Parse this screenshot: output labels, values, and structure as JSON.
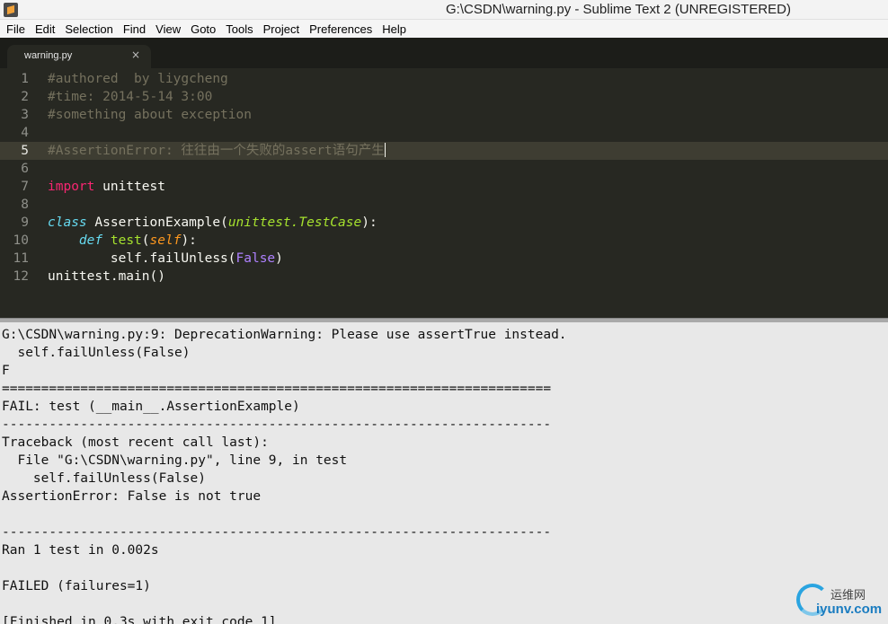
{
  "window": {
    "title": "G:\\CSDN\\warning.py - Sublime Text 2 (UNREGISTERED)"
  },
  "menu": [
    {
      "label": "File",
      "name": "menu-file"
    },
    {
      "label": "Edit",
      "name": "menu-edit"
    },
    {
      "label": "Selection",
      "name": "menu-selection"
    },
    {
      "label": "Find",
      "name": "menu-find"
    },
    {
      "label": "View",
      "name": "menu-view"
    },
    {
      "label": "Goto",
      "name": "menu-goto"
    },
    {
      "label": "Tools",
      "name": "menu-tools"
    },
    {
      "label": "Project",
      "name": "menu-project"
    },
    {
      "label": "Preferences",
      "name": "menu-preferences"
    },
    {
      "label": "Help",
      "name": "menu-help"
    }
  ],
  "tabs": [
    {
      "label": "warning.py",
      "close": "×",
      "active": true
    }
  ],
  "editor": {
    "active_line": 5,
    "line_numbers": [
      "1",
      "2",
      "3",
      "4",
      "5",
      "6",
      "7",
      "8",
      "9",
      "10",
      "11",
      "12"
    ],
    "lines": {
      "l1": "#authored  by liygcheng",
      "l2": "#time: 2014-5-14 3:00",
      "l3": "#something about exception",
      "l4": "",
      "l5": "#AssertionError: 往往由一个失败的assert语句产生",
      "l6": "",
      "l7_kw": "import",
      "l7_rest": " unittest",
      "l8": "",
      "l9_kw": "class",
      "l9_name": "AssertionExample",
      "l9_open": "(",
      "l9_parent": "unittest.TestCase",
      "l9_close": "):",
      "l10_indent": "    ",
      "l10_kw": "def",
      "l10_sp": " ",
      "l10_name": "test",
      "l10_open": "(",
      "l10_param": "self",
      "l10_close": "):",
      "l11_pre": "        self.failUnless(",
      "l11_const": "False",
      "l11_post": ")",
      "l12": "unittest.main()"
    }
  },
  "output": {
    "lines": [
      "G:\\CSDN\\warning.py:9: DeprecationWarning: Please use assertTrue instead.",
      "  self.failUnless(False)",
      "F",
      "======================================================================",
      "FAIL: test (__main__.AssertionExample)",
      "----------------------------------------------------------------------",
      "Traceback (most recent call last):",
      "  File \"G:\\CSDN\\warning.py\", line 9, in test",
      "    self.failUnless(False)",
      "AssertionError: False is not true",
      "",
      "----------------------------------------------------------------------",
      "Ran 1 test in 0.002s",
      "",
      "FAILED (failures=1)",
      "",
      "[Finished in 0.3s with exit code 1]"
    ]
  },
  "watermark": {
    "top": "运维网",
    "bottom": "iyunv.com"
  }
}
